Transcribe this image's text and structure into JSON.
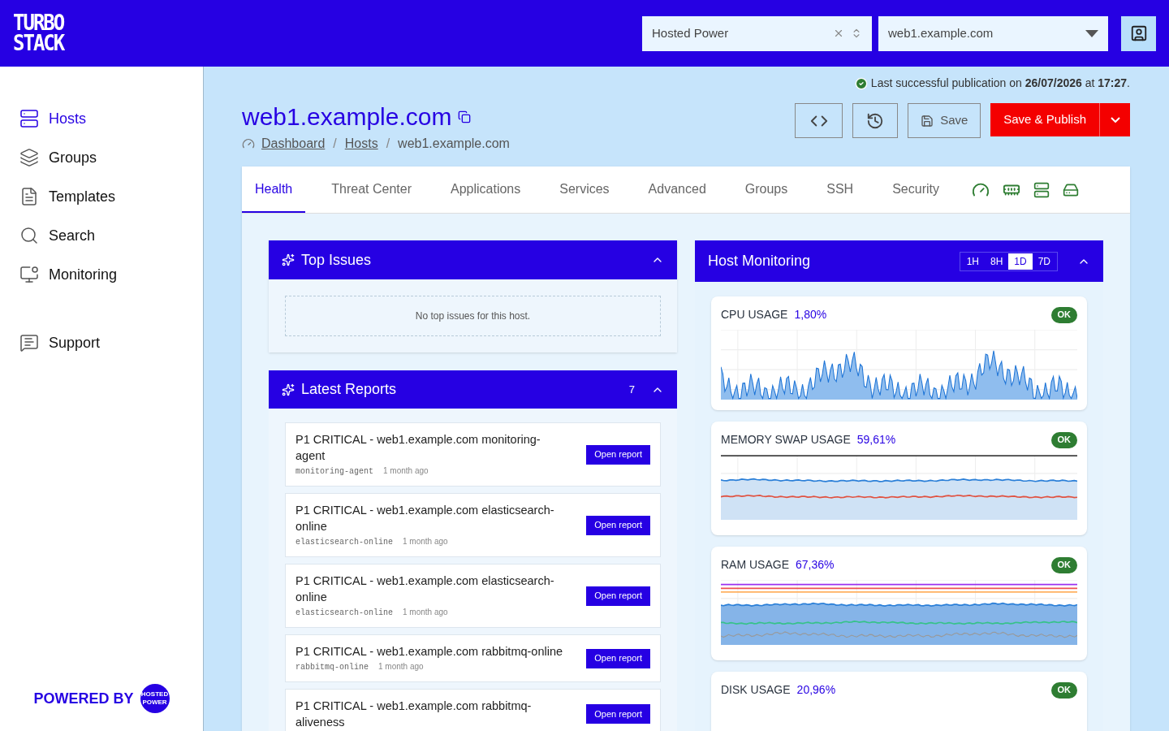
{
  "header": {
    "logo": [
      "TURBO",
      "STACK"
    ],
    "org_select": {
      "value": "Hosted Power"
    },
    "host_select": {
      "value": "web1.example.com"
    }
  },
  "sidebar": {
    "items": [
      {
        "label": "Hosts",
        "selected": true
      },
      {
        "label": "Groups",
        "selected": false
      },
      {
        "label": "Templates",
        "selected": false
      },
      {
        "label": "Search",
        "selected": false
      },
      {
        "label": "Monitoring",
        "selected": false
      },
      {
        "label": "Support",
        "selected": false
      }
    ],
    "powered_by": {
      "text": "POWERED BY",
      "logo": [
        "HOSTED",
        "POWER"
      ]
    }
  },
  "publication": "Last successful publication on **26/07/2026** at **17:27**.",
  "title": "web1.example.com",
  "breadcrumbs": [
    {
      "label": "Dashboard",
      "link": true
    },
    {
      "label": "/",
      "kind": "separator"
    },
    {
      "label": "Hosts",
      "link": true
    },
    {
      "label": "/",
      "kind": "separator"
    },
    {
      "label": "web1.example.com",
      "link": false
    }
  ],
  "actions": {
    "save": "Save",
    "publish": "Save & Publish"
  },
  "tabs": [
    {
      "label": "Health",
      "selected": true
    },
    {
      "label": "Threat Center",
      "selected": false
    },
    {
      "label": "Applications",
      "selected": false
    },
    {
      "label": "Services",
      "selected": false
    },
    {
      "label": "Advanced",
      "selected": false
    },
    {
      "label": "Groups",
      "selected": false
    },
    {
      "label": "SSH",
      "selected": false
    },
    {
      "label": "Security",
      "selected": false
    }
  ],
  "top_issues": {
    "title": "Top Issues",
    "expanded": true,
    "empty_text": "No top issues for this host."
  },
  "latest_reports": {
    "title": "Latest Reports",
    "count": "7",
    "expanded": true,
    "items": [
      {
        "title": "P1 CRITICAL - web1.example.com monitoring-agent",
        "source": "monitoring-agent",
        "time": "1 month ago",
        "button": "Open report"
      },
      {
        "title": "P1 CRITICAL - web1.example.com elasticsearch-online",
        "source": "elasticsearch-online",
        "time": "1 month ago",
        "button": "Open report"
      },
      {
        "title": "P1 CRITICAL - web1.example.com elasticsearch-online",
        "source": "elasticsearch-online",
        "time": "1 month ago",
        "button": "Open report"
      },
      {
        "title": "P1 CRITICAL - web1.example.com rabbitmq-online",
        "source": "rabbitmq-online",
        "time": "1 month ago",
        "button": "Open report"
      },
      {
        "title": "P1 CRITICAL - web1.example.com rabbitmq-aliveness",
        "button": "Open report"
      }
    ]
  },
  "monitoring": {
    "title": "Host Monitoring",
    "expanded": true,
    "ranges": [
      {
        "label": "1H",
        "selected": false
      },
      {
        "label": "8H",
        "selected": false
      },
      {
        "label": "1D",
        "selected": true
      },
      {
        "label": "7D",
        "selected": false
      }
    ],
    "metrics": [
      {
        "label": "CPU USAGE",
        "value": "1,80%",
        "status": "OK",
        "kind": "cpu"
      },
      {
        "label": "MEMORY SWAP USAGE",
        "value": "59,61%",
        "status": "OK",
        "kind": "swap"
      },
      {
        "label": "RAM USAGE",
        "value": "67,36%",
        "status": "OK",
        "kind": "ram"
      },
      {
        "label": "DISK USAGE",
        "value": "20,96%",
        "status": "OK",
        "kind": "disk"
      }
    ]
  }
}
